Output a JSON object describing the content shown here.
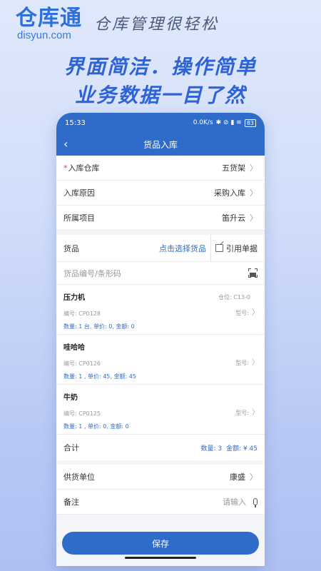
{
  "brand": {
    "logo": "仓库通",
    "url": "disyun.com",
    "slogan": "仓库管理很轻松"
  },
  "hero": {
    "line1": "界面简洁．操作简单",
    "line2": "业务数据一目了然"
  },
  "status": {
    "time": "15:33",
    "net": "0.0K/s",
    "signal": "✱ ⊘ ▮ ≋",
    "battery": "83"
  },
  "nav": {
    "title": "货品入库",
    "back_icon": "‹"
  },
  "form": {
    "warehouse_req": "*",
    "warehouse_label": "入库仓库",
    "warehouse_value": "五货架",
    "reason_label": "入库原因",
    "reason_value": "采购入库",
    "project_label": "所属项目",
    "project_value": "笛升云"
  },
  "goods": {
    "label": "货品",
    "pick": "点击选择货品",
    "ref": "引用单据",
    "search_placeholder": "货品编号/条形码"
  },
  "items": [
    {
      "name": "压力机",
      "loc": "仓位: C13-0",
      "code": "编号: CP0128",
      "type": "型号:",
      "sum": "数量: 1 台, 单价: 0, 金额: 0"
    },
    {
      "name": "哇哈哈",
      "loc": "",
      "code": "编号: CP0126",
      "type": "型号:",
      "sum": "数量: 1 , 单价: 45, 金额: 45"
    },
    {
      "name": "牛奶",
      "loc": "",
      "code": "编号: CP0125",
      "type": "型号:",
      "sum": "数量: 1 , 单价: 0, 金额: 0"
    }
  ],
  "total": {
    "label": "合计",
    "qty": "数量: 3",
    "amount": "金额: ¥ 45"
  },
  "supplier": {
    "label": "供货单位",
    "value": "康盛"
  },
  "remark": {
    "label": "备注",
    "placeholder": "请输入"
  },
  "save": "保存",
  "chevron": "〉",
  "colors": {
    "primary": "#2f6cc9",
    "accent": "#2e63d6"
  }
}
